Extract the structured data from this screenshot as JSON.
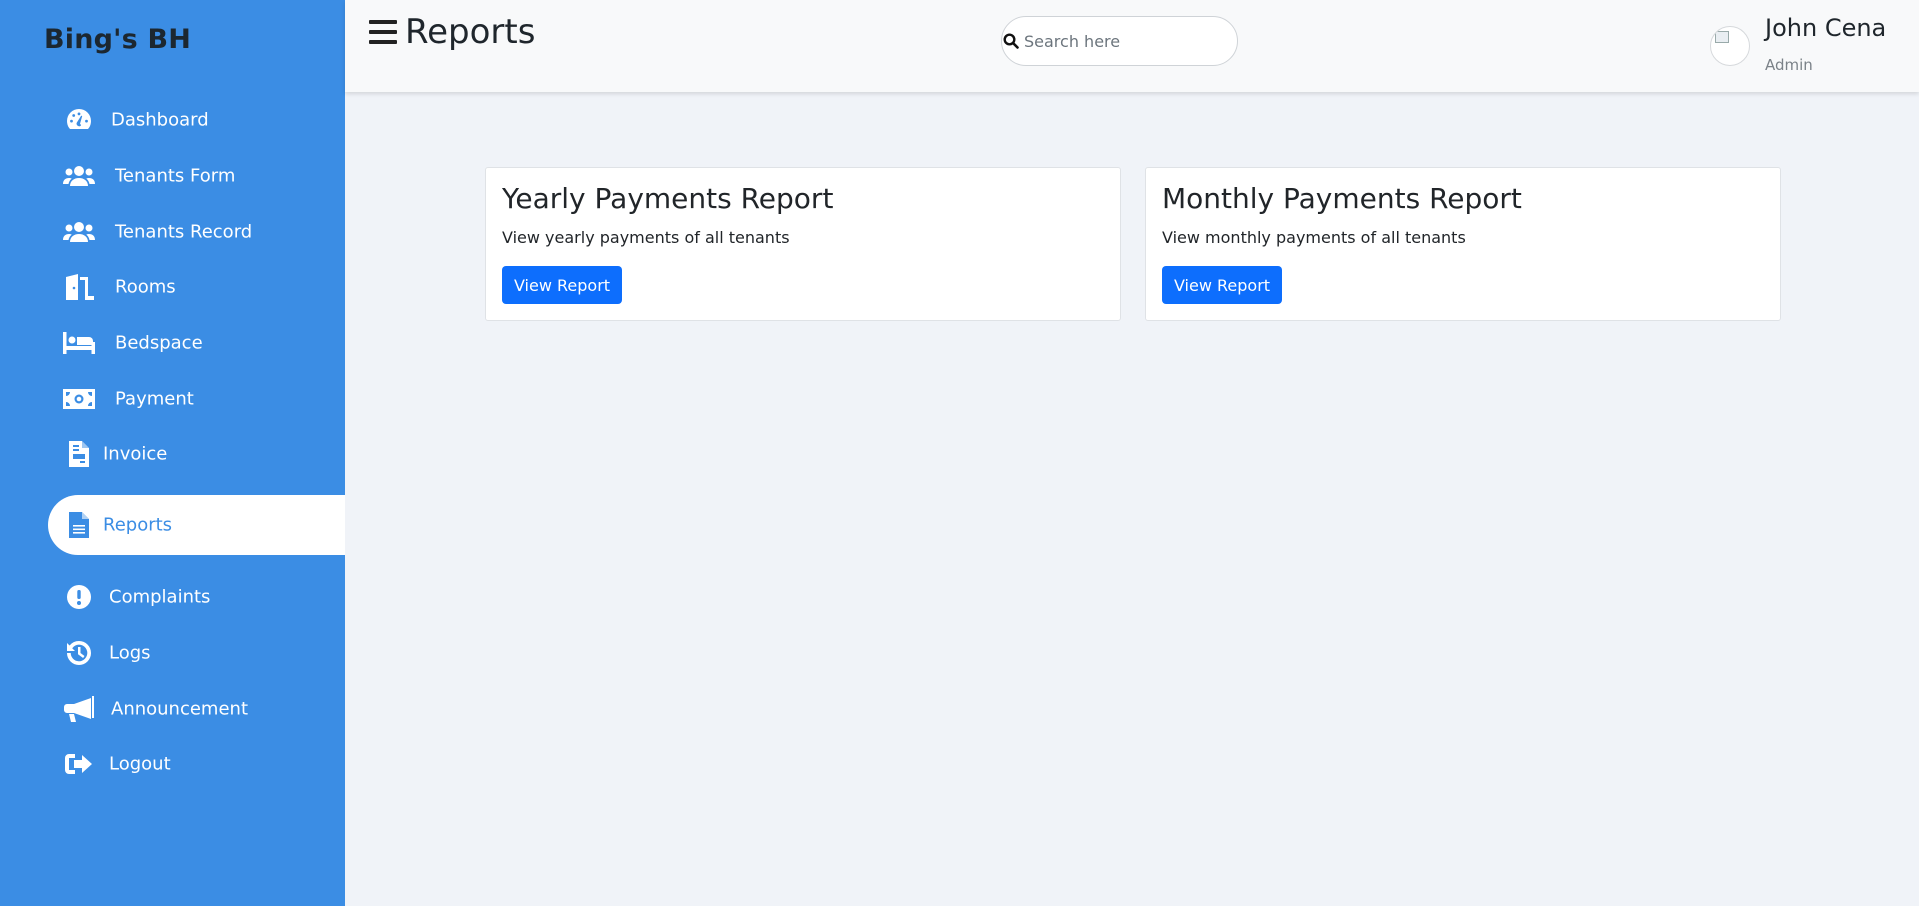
{
  "brand": "Bing's BH",
  "sidebar": {
    "items": [
      {
        "label": "Dashboard",
        "icon": "gauge-icon"
      },
      {
        "label": "Tenants Form",
        "icon": "users-icon"
      },
      {
        "label": "Tenants Record",
        "icon": "users-icon"
      },
      {
        "label": "Rooms",
        "icon": "door-icon"
      },
      {
        "label": "Bedspace",
        "icon": "bed-icon"
      },
      {
        "label": "Payment",
        "icon": "money-bill-icon"
      },
      {
        "label": "Invoice",
        "icon": "invoice-icon"
      },
      {
        "label": "Reports",
        "icon": "file-icon",
        "active": true
      },
      {
        "label": "Complaints",
        "icon": "exclamation-circle-icon"
      },
      {
        "label": "Logs",
        "icon": "history-icon"
      },
      {
        "label": "Announcement",
        "icon": "bullhorn-icon"
      },
      {
        "label": "Logout",
        "icon": "sign-out-icon"
      }
    ]
  },
  "header": {
    "title": "Reports",
    "search_placeholder": "Search here",
    "user_name": "John Cena",
    "user_role": "Admin"
  },
  "cards": [
    {
      "title": "Yearly Payments Report",
      "description": "View yearly payments of all tenants",
      "button": "View Report"
    },
    {
      "title": "Monthly Payments Report",
      "description": "View monthly payments of all tenants",
      "button": "View Report"
    }
  ],
  "colors": {
    "sidebar": "#3b8de4",
    "primary_button": "#0d6efd",
    "background": "#f0f3f8"
  }
}
